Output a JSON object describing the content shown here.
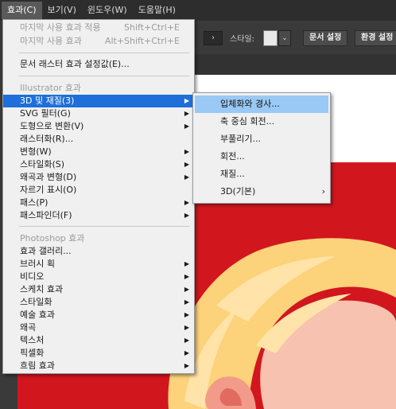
{
  "menubar": {
    "items": [
      {
        "label": "효과(C)",
        "active": true
      },
      {
        "label": "보기(V)"
      },
      {
        "label": "윈도우(W)"
      },
      {
        "label": "도움말(H)"
      }
    ]
  },
  "controlbar": {
    "dropdown_glyph": "›",
    "style_label": "스타일:",
    "style_drop_glyph": "⌄",
    "doc_setup": "문서 설정",
    "preferences": "환경 설정"
  },
  "effect_menu": {
    "recent": [
      {
        "label": "마지막 사용 효과 적용",
        "shortcut": "Shift+Ctrl+E"
      },
      {
        "label": "마지막 사용 효과",
        "shortcut": "Alt+Shift+Ctrl+E"
      }
    ],
    "raster_settings": "문서 래스터 효과 설정값(E)...",
    "illustrator_header": "Illustrator 효과",
    "illustrator_items": [
      "3D 및 재질(3)",
      "SVG 필터(G)",
      "도형으로 변환(V)",
      "래스터화(R)...",
      "변형(W)",
      "스타일화(S)",
      "왜곡과 변형(D)",
      "자르기 표시(O)",
      "패스(P)",
      "패스파인더(F)"
    ],
    "photoshop_header": "Photoshop 효과",
    "photoshop_items": [
      "효과 갤러리...",
      "브러시 획",
      "비디오",
      "스케치 효과",
      "스타일화",
      "예술 효과",
      "왜곡",
      "텍스처",
      "픽셀화",
      "흐림 효과"
    ]
  },
  "submenu_3d": {
    "items": [
      "입체화와 경사...",
      "축 중심 회전...",
      "부풀리기...",
      "회전...",
      "재질...",
      "3D(기본)"
    ]
  },
  "colors": {
    "highlight": "#1e6fd9",
    "submenu_highlight": "#99c9f4",
    "canvas_red": "#d2161e",
    "hair": "#fcd27a",
    "skin": "#f7c2b0"
  }
}
